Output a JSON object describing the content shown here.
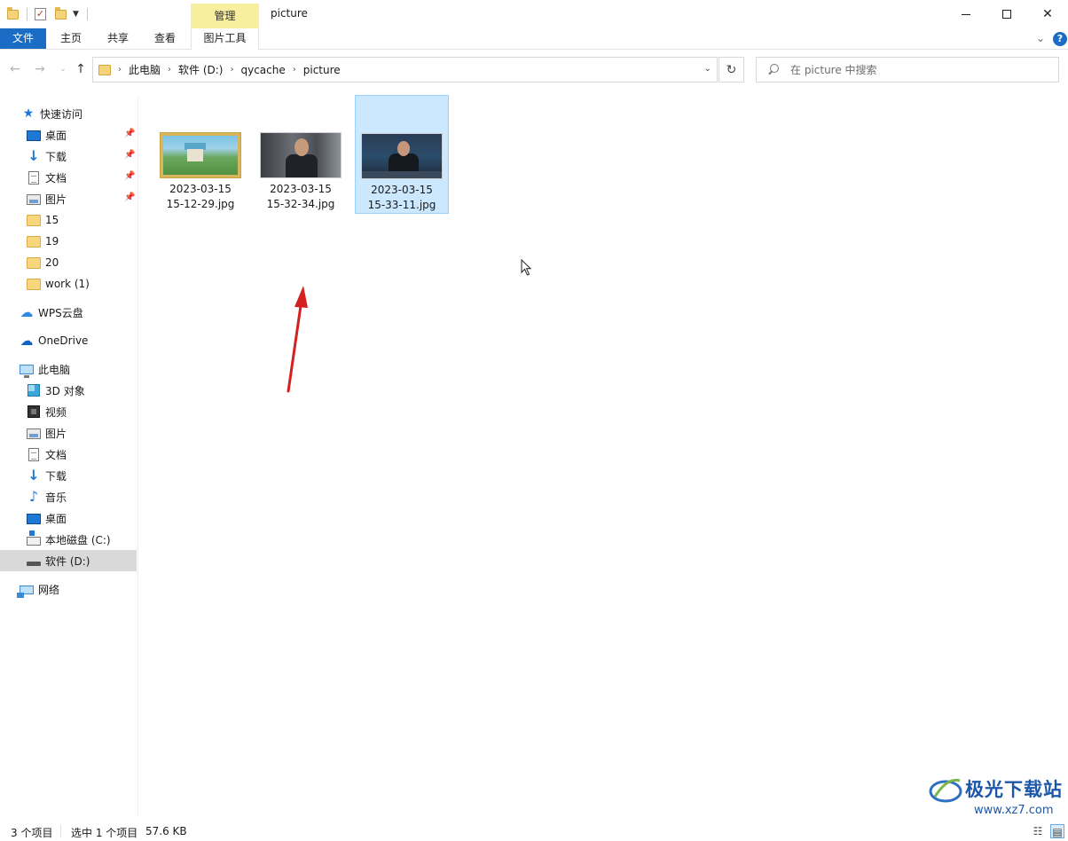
{
  "window": {
    "title": "picture",
    "context_tab": "管理",
    "minimize_glyph": "",
    "close_glyph": "✕"
  },
  "ribbon": {
    "tabs": [
      "文件",
      "主页",
      "共享",
      "查看",
      "图片工具"
    ],
    "help": "?"
  },
  "address": {
    "breadcrumbs": [
      "此电脑",
      "软件 (D:)",
      "qycache",
      "picture"
    ],
    "refresh_glyph": "↻"
  },
  "search": {
    "placeholder": "在 picture 中搜索"
  },
  "sidebar": {
    "quick_access": "快速访问",
    "quick_items": [
      "桌面",
      "下载",
      "文档",
      "图片",
      "15",
      "19",
      "20",
      "work (1)"
    ],
    "wps_cloud": "WPS云盘",
    "onedrive": "OneDrive",
    "this_pc": "此电脑",
    "pc_items": [
      "3D 对象",
      "视频",
      "图片",
      "文档",
      "下载",
      "音乐",
      "桌面",
      "本地磁盘 (C:)",
      "软件 (D:)"
    ],
    "network": "网络"
  },
  "files": [
    {
      "name": "2023-03-15\n15-12-29.jpg",
      "selected": false
    },
    {
      "name": "2023-03-15\n15-32-34.jpg",
      "selected": false
    },
    {
      "name": "2023-03-15\n15-33-11.jpg",
      "selected": true
    }
  ],
  "status": {
    "item_count": "3 个项目",
    "selected": "选中 1 个项目",
    "size": "57.6 KB"
  },
  "watermark": {
    "brand": "极光下载站",
    "url": "www.xz7.com"
  },
  "colors": {
    "accent": "#1a6cc4",
    "selection": "#cce8ff",
    "context_tab": "#f7ef9e",
    "annotation_arrow": "#d42020"
  }
}
